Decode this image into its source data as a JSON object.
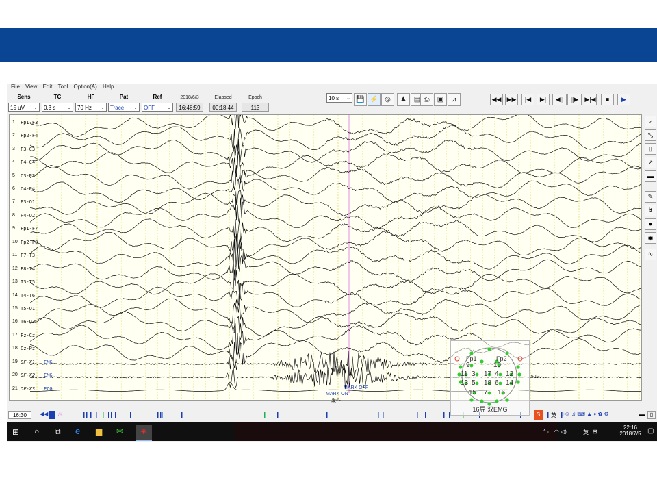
{
  "menu": [
    "File",
    "View",
    "Edit",
    "Tool",
    "Option(A)",
    "Help"
  ],
  "toolbar": {
    "sens": {
      "label": "Sens",
      "value": "15 uV"
    },
    "tc": {
      "label": "TC",
      "value": "0.3 s"
    },
    "hf": {
      "label": "HF",
      "value": "70 Hz"
    },
    "pat": {
      "label": "Pat",
      "value": "Trace"
    },
    "ref": {
      "label": "Ref",
      "value": "OFF"
    },
    "date": {
      "label": "2018/6/3",
      "value": "16:48:59"
    },
    "elapsed": {
      "label": "Elapsed",
      "value": "00:18:44"
    },
    "epoch": {
      "label": "Epoch",
      "value": "113"
    },
    "page_speed": "10 s",
    "playback_buttons": [
      "◀◀",
      "▶▶",
      "|◀",
      "▶|",
      "◀||",
      "||▶",
      "▶|◀",
      "■",
      "▶"
    ]
  },
  "channels": [
    {
      "num": "1",
      "label": "Fp1-F3"
    },
    {
      "num": "2",
      "label": "Fp2-F4"
    },
    {
      "num": "3",
      "label": "F3-C3"
    },
    {
      "num": "4",
      "label": "F4-C4"
    },
    {
      "num": "5",
      "label": "C3-P3"
    },
    {
      "num": "6",
      "label": "C4-P4"
    },
    {
      "num": "7",
      "label": "P3-O1"
    },
    {
      "num": "8",
      "label": "P4-O2"
    },
    {
      "num": "9",
      "label": "Fp1-F7"
    },
    {
      "num": "10",
      "label": "Fp2-F8"
    },
    {
      "num": "11",
      "label": "F7-T3"
    },
    {
      "num": "12",
      "label": "F8-T4"
    },
    {
      "num": "13",
      "label": "T3-T5"
    },
    {
      "num": "14",
      "label": "T4-T6"
    },
    {
      "num": "15",
      "label": "T5-O1"
    },
    {
      "num": "16",
      "label": "T6-O2"
    },
    {
      "num": "17",
      "label": "Fz-Cz"
    },
    {
      "num": "18",
      "label": "Cz-Pz"
    },
    {
      "num": "19",
      "label": "OF-X1",
      "tag": "EMG"
    },
    {
      "num": "20",
      "label": "OF-X2",
      "tag": "EMG"
    },
    {
      "num": "21",
      "label": "OF-X3",
      "tag": "ECG"
    }
  ],
  "scale_label": "75uV",
  "markers": {
    "marker1": "MARK ON",
    "marker2": "MARK OFF",
    "event": "发作"
  },
  "headmap": {
    "top_labels": [
      "Fp1",
      "Fp2"
    ],
    "electrodes": [
      "9",
      "10",
      "11",
      "3",
      "17",
      "4",
      "12",
      "13",
      "5",
      "18",
      "6",
      "14",
      "15",
      "7",
      "16"
    ],
    "caption": "16导 双EMG"
  },
  "timeline": {
    "time": "16:30"
  },
  "taskbar": {
    "ime": "英",
    "lang": "英",
    "clock_time": "22:16",
    "clock_date": "2018/7/5"
  },
  "colors": {
    "banner": "#0a4593",
    "eeg_bg": "#fffff2",
    "grid": "#e8e27a",
    "trace": "#111111",
    "marker": "#e070e0"
  }
}
